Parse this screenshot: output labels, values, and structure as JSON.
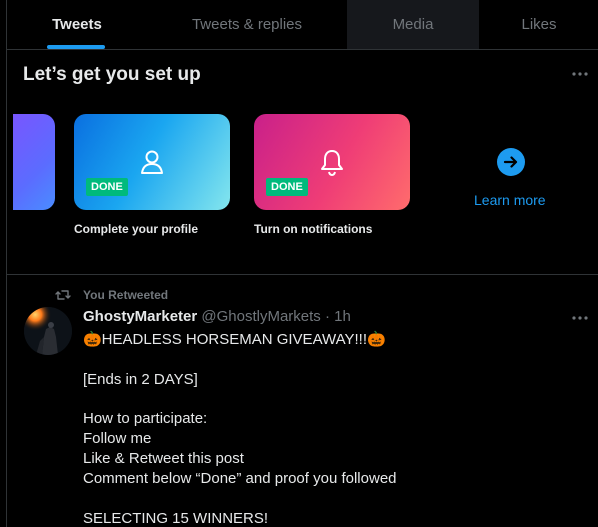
{
  "tabs": [
    {
      "label": "Tweets",
      "active": true
    },
    {
      "label": "Tweets & replies",
      "active": false
    },
    {
      "label": "Media",
      "active": false
    },
    {
      "label": "Likes",
      "active": false
    }
  ],
  "setup": {
    "title": "Let’s get you set up",
    "more_icon": "more-horizontal-icon",
    "cards": [
      {
        "label": "Complete your profile",
        "badge": "DONE",
        "icon": "person-icon"
      },
      {
        "label": "Turn on notifications",
        "badge": "DONE",
        "icon": "bell-icon"
      }
    ],
    "learn_more": {
      "label": "Learn more",
      "icon": "arrow-right-circle-icon"
    }
  },
  "tweet": {
    "retweet_label": "You Retweeted",
    "author_name": "GhostyMarketer",
    "author_handle": "@GhostlyMarkets",
    "separator": "·",
    "time": "1h",
    "lines": [
      "🎃HEADLESS HORSEMAN GIVEAWAY!!!🎃",
      "[Ends in 2 DAYS]",
      "How to participate:",
      "Follow me",
      "Like & Retweet this post",
      "Comment below “Done” and proof you followed",
      "SELECTING 15 WINNERS!"
    ]
  },
  "colors": {
    "background": "#000000",
    "accent": "#1d9bf0",
    "done_badge": "#00ba7c",
    "muted_text": "#71767b",
    "divider": "#2f3336"
  }
}
